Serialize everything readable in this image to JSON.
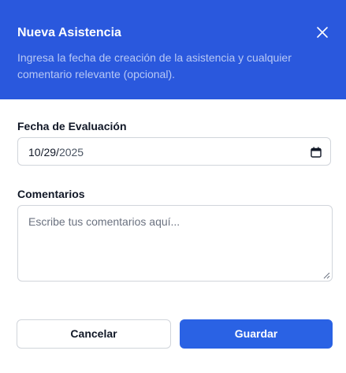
{
  "dialog": {
    "title": "Nueva Asistencia",
    "description": "Ingresa la fecha de creación de la asistencia y cualquier comentario relevante (opcional).",
    "close_icon": "close-icon"
  },
  "form": {
    "date": {
      "label": "Fecha de Evaluación",
      "value_month_day": "10/29/",
      "value_year": "2025",
      "icon": "calendar-icon"
    },
    "comments": {
      "label": "Comentarios",
      "placeholder": "Escribe tus comentarios aquí...",
      "value": ""
    }
  },
  "actions": {
    "cancel_label": "Cancelar",
    "save_label": "Guardar"
  },
  "colors": {
    "header_bg": "#2a58dd",
    "primary": "#2a62e4",
    "subtitle_text": "#b8c8f5",
    "border": "#d1d5db"
  }
}
